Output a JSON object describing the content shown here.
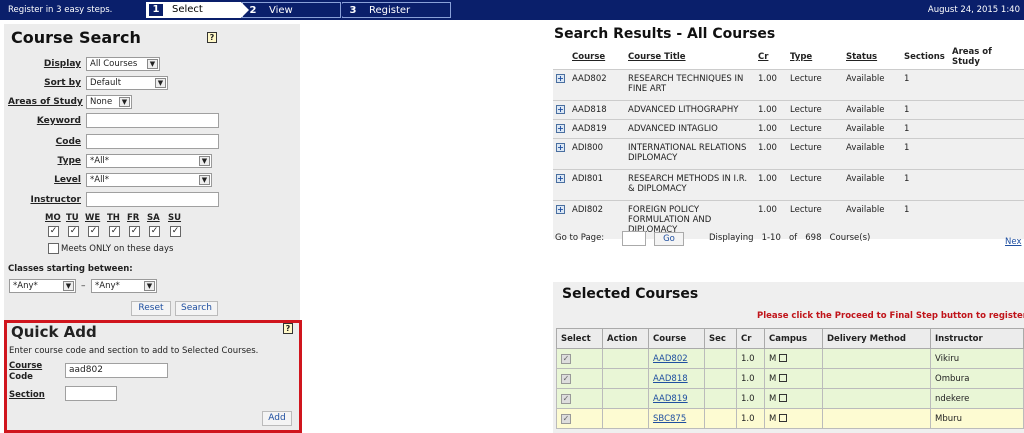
{
  "header": {
    "intro": "Register in 3 easy steps.",
    "steps": [
      {
        "num": "1",
        "label": "Select"
      },
      {
        "num": "2",
        "label": "View"
      },
      {
        "num": "3",
        "label": "Register"
      }
    ],
    "date": "August 24, 2015 1:40"
  },
  "course_search": {
    "title": "Course Search",
    "help": "?",
    "display_label": "Display",
    "display_value": "All Courses",
    "sortby_label": "Sort by",
    "sortby_value": "Default",
    "areas_label": "Areas of Study",
    "areas_value": "None",
    "keyword_label": "Keyword",
    "code_label": "Code",
    "type_label": "Type",
    "type_value": "*All*",
    "level_label": "Level",
    "level_value": "*All*",
    "instructor_label": "Instructor",
    "days": [
      "MO",
      "TU",
      "WE",
      "TH",
      "FR",
      "SA",
      "SU"
    ],
    "meets_only_label": "Meets ONLY on these days",
    "classes_between_label": "Classes starting between:",
    "start_value": "*Any*",
    "dash": "–",
    "end_value": "*Any*",
    "reset_label": "Reset",
    "search_label": "Search"
  },
  "quick_add": {
    "title": "Quick Add",
    "help": "?",
    "instructions": "Enter course code and section to add to Selected Courses.",
    "course_code_label_1": "Course",
    "course_code_label_2": "Code",
    "course_code_value": "aad802",
    "section_label": "Section",
    "add_label": "Add"
  },
  "search_results": {
    "title": "Search Results -  All Courses",
    "columns": [
      "Course",
      "Course Title",
      "Cr",
      "Type",
      "Status",
      "Sections",
      "Areas of Study"
    ],
    "rows": [
      {
        "course": "AAD802",
        "title": "RESEARCH TECHNIQUES IN FINE ART",
        "cr": "1.00",
        "type": "Lecture",
        "status": "Available",
        "sections": "1"
      },
      {
        "course": "AAD818",
        "title": "ADVANCED LITHOGRAPHY",
        "cr": "1.00",
        "type": "Lecture",
        "status": "Available",
        "sections": "1"
      },
      {
        "course": "AAD819",
        "title": "ADVANCED INTAGLIO",
        "cr": "1.00",
        "type": "Lecture",
        "status": "Available",
        "sections": "1"
      },
      {
        "course": "ADI800",
        "title": "INTERNATIONAL RELATIONS DIPLOMACY",
        "cr": "1.00",
        "type": "Lecture",
        "status": "Available",
        "sections": "1"
      },
      {
        "course": "ADI801",
        "title": "RESEARCH METHODS IN I.R. & DIPLOMACY",
        "cr": "1.00",
        "type": "Lecture",
        "status": "Available",
        "sections": "1"
      },
      {
        "course": "ADI802",
        "title": "FOREIGN POLICY FORMULATION AND DIPLOMACY",
        "cr": "1.00",
        "type": "Lecture",
        "status": "Available",
        "sections": "1"
      }
    ],
    "goto_label": "Go to Page:",
    "go_label": "Go",
    "displaying": "Displaying   1-10   of   698   Course(s)",
    "next_label": "Nex"
  },
  "selected_courses": {
    "title": "Selected Courses",
    "notice": "Please click the Proceed to Final Step button to register",
    "columns": [
      "Select",
      "Action",
      "Course",
      "Sec",
      "Cr",
      "Campus",
      "Delivery Method",
      "Instructor"
    ],
    "rows": [
      {
        "course": "AAD802",
        "cr": "1.0",
        "campus": "M",
        "instructor": "Vikiru"
      },
      {
        "course": "AAD818",
        "cr": "1.0",
        "campus": "M",
        "instructor": "Ombura"
      },
      {
        "course": "AAD819",
        "cr": "1.0",
        "campus": "M",
        "instructor": "ndekere"
      },
      {
        "course": "SBC875",
        "cr": "1.0",
        "campus": "M",
        "instructor": "Mburu"
      }
    ]
  }
}
